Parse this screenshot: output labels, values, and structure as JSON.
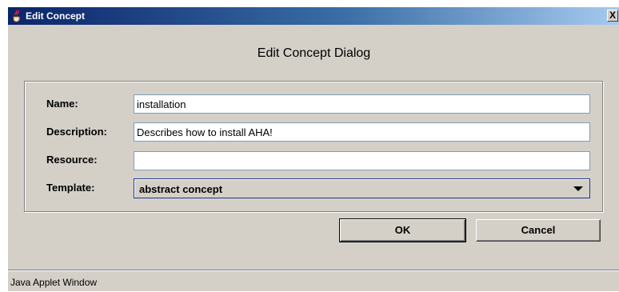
{
  "window": {
    "title": "Edit Concept",
    "close_label": "X",
    "title_icon": "java-cup-icon"
  },
  "dialog": {
    "heading": "Edit Concept Dialog"
  },
  "form": {
    "name": {
      "label": "Name:",
      "value": "installation"
    },
    "description": {
      "label": "Description:",
      "value": "Describes how to install AHA!"
    },
    "resource": {
      "label": "Resource:",
      "value": ""
    },
    "template": {
      "label": "Template:",
      "selected": "abstract concept"
    }
  },
  "buttons": {
    "ok": "OK",
    "cancel": "Cancel"
  },
  "status": {
    "text": "Java Applet Window"
  },
  "colors": {
    "titlebar_start": "#0a246a",
    "titlebar_end": "#a6caf0",
    "dialog_bg": "#d4d0c8"
  }
}
